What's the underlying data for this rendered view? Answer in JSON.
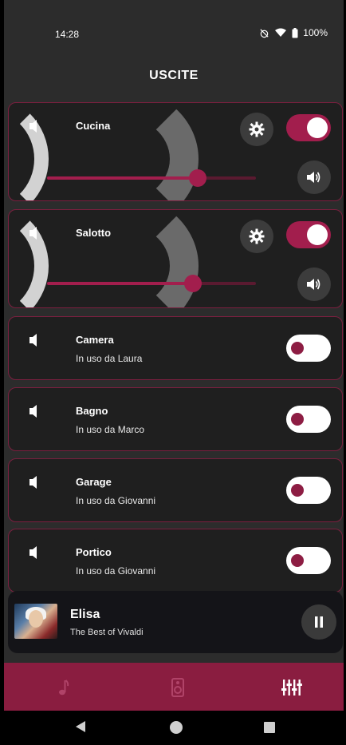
{
  "status": {
    "time": "14:28",
    "battery": "100%"
  },
  "title": "USCITE",
  "rooms": [
    {
      "name": "Cucina",
      "subtitle": "",
      "active": true,
      "volume": 0.72
    },
    {
      "name": "Salotto",
      "subtitle": "",
      "active": true,
      "volume": 0.7
    },
    {
      "name": "Camera",
      "subtitle": "In uso da Laura",
      "active": false
    },
    {
      "name": "Bagno",
      "subtitle": "In uso da Marco",
      "active": false
    },
    {
      "name": "Garage",
      "subtitle": "In uso da Giovanni",
      "active": false
    },
    {
      "name": "Portico",
      "subtitle": "In uso da Giovanni",
      "active": false
    }
  ],
  "player": {
    "title": "Elisa",
    "subtitle": "The Best of Vivaldi",
    "state": "playing"
  },
  "nav": {
    "items": [
      {
        "icon": "music-note-icon",
        "active": false
      },
      {
        "icon": "speaker-icon",
        "active": false
      },
      {
        "icon": "equalizer-icon",
        "active": true
      }
    ]
  },
  "colors": {
    "accent": "#a21e4d",
    "card_border": "#7b1f3f",
    "nav_bar": "#8a1d40"
  }
}
